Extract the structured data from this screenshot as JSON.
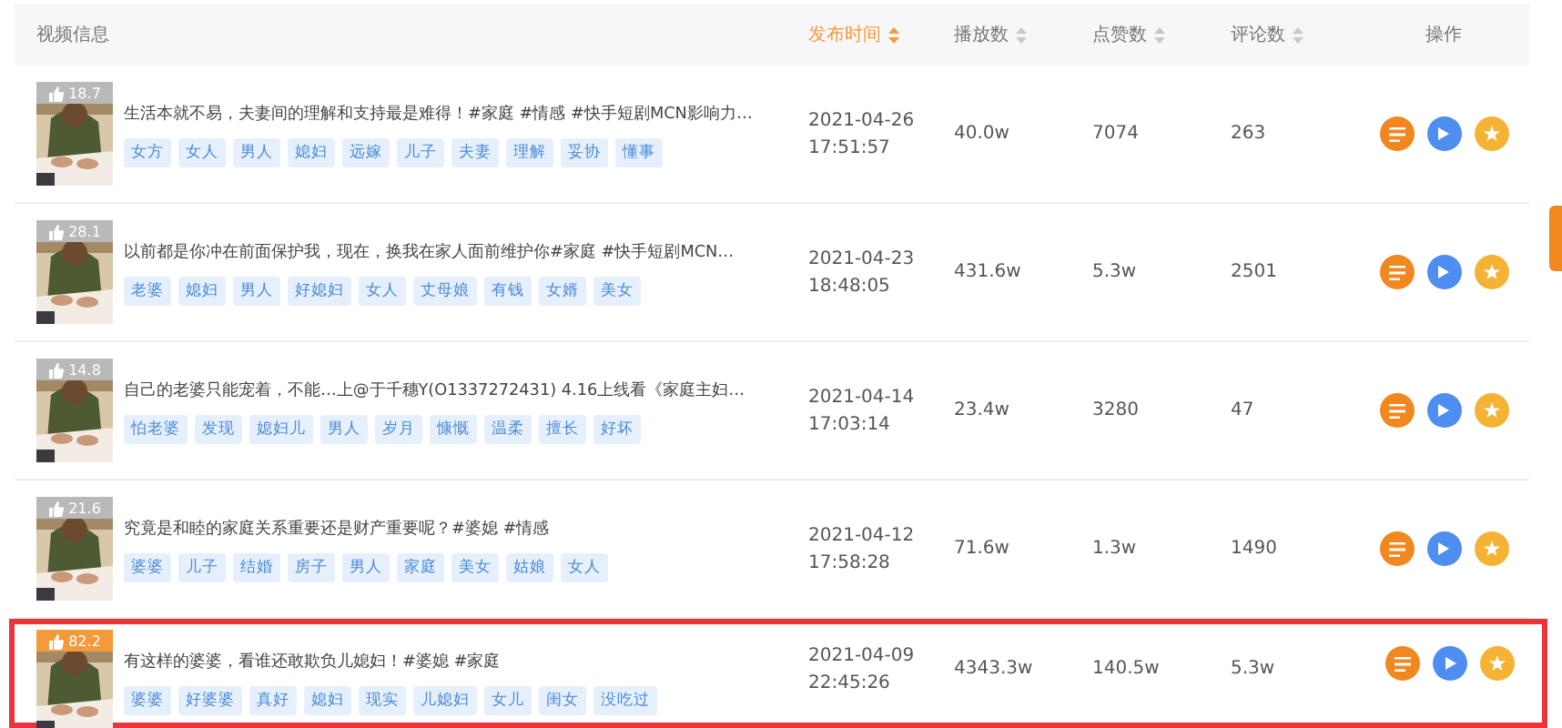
{
  "table": {
    "columns": [
      {
        "label": "视频信息",
        "sortable": false,
        "sorted": false
      },
      {
        "label": "发布时间",
        "sortable": true,
        "sorted": true
      },
      {
        "label": "播放数",
        "sortable": true,
        "sorted": false
      },
      {
        "label": "点赞数",
        "sortable": true,
        "sorted": false
      },
      {
        "label": "评论数",
        "sortable": true,
        "sorted": false
      },
      {
        "label": "操作",
        "sortable": false,
        "sorted": false
      }
    ],
    "rows": [
      {
        "score": "18.7",
        "hot": false,
        "highlighted": false,
        "title": "生活本就不易，夫妻间的理解和支持最是难得！#家庭 #情感 #快手短剧MCN影响力…",
        "tags": [
          "女方",
          "女人",
          "男人",
          "媳妇",
          "远嫁",
          "儿子",
          "夫妻",
          "理解",
          "妥协",
          "懂事"
        ],
        "date": "2021-04-26",
        "time": "17:51:57",
        "plays": "40.0w",
        "likes": "7074",
        "comments": "263"
      },
      {
        "score": "28.1",
        "hot": false,
        "highlighted": false,
        "title": "以前都是你冲在前面保护我，现在，换我在家人面前维护你#家庭 #快手短剧MCN…",
        "tags": [
          "老婆",
          "媳妇",
          "男人",
          "好媳妇",
          "女人",
          "丈母娘",
          "有钱",
          "女婿",
          "美女"
        ],
        "date": "2021-04-23",
        "time": "18:48:05",
        "plays": "431.6w",
        "likes": "5.3w",
        "comments": "2501"
      },
      {
        "score": "14.8",
        "hot": false,
        "highlighted": false,
        "title": "自己的老婆只能宠着，不能…上@于千穗Y(O1337272431) 4.16上线看《家庭主妇…",
        "tags": [
          "怕老婆",
          "发现",
          "媳妇儿",
          "男人",
          "岁月",
          "慷慨",
          "温柔",
          "擅长",
          "好坏"
        ],
        "date": "2021-04-14",
        "time": "17:03:14",
        "plays": "23.4w",
        "likes": "3280",
        "comments": "47"
      },
      {
        "score": "21.6",
        "hot": false,
        "highlighted": false,
        "title": "究竟是和睦的家庭关系重要还是财产重要呢？#婆媳 #情感",
        "tags": [
          "婆婆",
          "儿子",
          "结婚",
          "房子",
          "男人",
          "家庭",
          "美女",
          "姑娘",
          "女人"
        ],
        "date": "2021-04-12",
        "time": "17:58:28",
        "plays": "71.6w",
        "likes": "1.3w",
        "comments": "1490"
      },
      {
        "score": "82.2",
        "hot": true,
        "highlighted": true,
        "title": "有这样的婆婆，看谁还敢欺负儿媳妇！#婆媳 #家庭",
        "tags": [
          "婆婆",
          "好婆婆",
          "真好",
          "媳妇",
          "现实",
          "儿媳妇",
          "女儿",
          "闺女",
          "没吃过"
        ],
        "date": "2021-04-09",
        "time": "22:45:26",
        "plays": "4343.3w",
        "likes": "140.5w",
        "comments": "5.3w"
      }
    ]
  }
}
